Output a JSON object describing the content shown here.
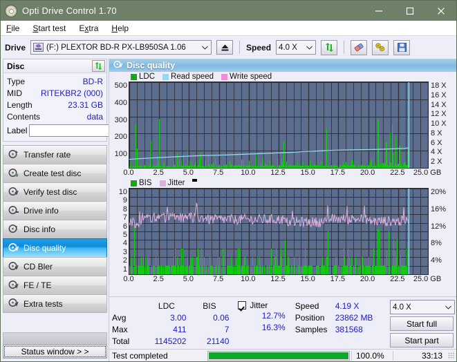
{
  "window": {
    "title": "Opti Drive Control 1.70",
    "icon": "disc-icon",
    "minimize": "minimize-icon",
    "maximize": "maximize-icon",
    "close": "close-icon"
  },
  "menu": [
    {
      "label": "File",
      "accel": "F"
    },
    {
      "label": "Start test",
      "accel": "S"
    },
    {
      "label": "Extra",
      "accel": "x"
    },
    {
      "label": "Help",
      "accel": "H"
    }
  ],
  "drivebar": {
    "drive_label": "Drive",
    "drive_value": "(F:)   PLEXTOR BD-R  PX-LB950SA 1.06",
    "eject_icon": "eject-icon",
    "speed_label": "Speed",
    "speed_value": "4.0 X",
    "refresh_icon": "refresh-icon",
    "erase_icon": "eraser-icon",
    "tools_icon": "tools-icon",
    "save_icon": "save-icon"
  },
  "disc_panel": {
    "title": "Disc",
    "refresh_icon": "refresh-icon",
    "rows": [
      {
        "key": "Type",
        "value": "BD-R"
      },
      {
        "key": "MID",
        "value": "RITEKBR2 (000)"
      },
      {
        "key": "Length",
        "value": "23.31 GB"
      },
      {
        "key": "Contents",
        "value": "data"
      }
    ],
    "label_key": "Label",
    "label_value": "",
    "label_placeholder": "",
    "label_button_icon": "disc-icon"
  },
  "sidebar": {
    "items": [
      {
        "label": "Transfer rate",
        "icon": "disc-transfer-icon",
        "selected": false
      },
      {
        "label": "Create test disc",
        "icon": "disc-create-icon",
        "selected": false
      },
      {
        "label": "Verify test disc",
        "icon": "disc-verify-icon",
        "selected": false
      },
      {
        "label": "Drive info",
        "icon": "disc-drive-icon",
        "selected": false
      },
      {
        "label": "Disc info",
        "icon": "disc-info-icon",
        "selected": false
      },
      {
        "label": "Disc quality",
        "icon": "disc-quality-icon",
        "selected": true
      },
      {
        "label": "CD Bler",
        "icon": "disc-bler-icon",
        "selected": false
      },
      {
        "label": "FE / TE",
        "icon": "disc-fete-icon",
        "selected": false
      },
      {
        "label": "Extra tests",
        "icon": "disc-extra-icon",
        "selected": false
      }
    ],
    "status_window_button": "Status window > >"
  },
  "content_header": {
    "title": "Disc quality",
    "icon": "disc-quality-icon"
  },
  "chart_data": [
    {
      "type": "line",
      "name": "ldc-chart",
      "title": "",
      "xlabel": "GB",
      "ylabel": "",
      "xlim": [
        0,
        25
      ],
      "ylim": [
        0,
        500
      ],
      "y2lim": [
        0,
        18
      ],
      "grid": true,
      "legend_position": "top-left",
      "xticks": [
        "0.0",
        "2.5",
        "5.0",
        "7.5",
        "10.0",
        "12.5",
        "15.0",
        "17.5",
        "20.0",
        "22.5",
        "25.0 GB"
      ],
      "yticks": [
        "500",
        "400",
        "300",
        "200",
        "100"
      ],
      "y2ticks": [
        "18 X",
        "16 X",
        "14 X",
        "12 X",
        "10 X",
        "8 X",
        "6 X",
        "4 X",
        "2 X"
      ],
      "legend": [
        {
          "name": "LDC",
          "color": "#14a814"
        },
        {
          "name": "Read speed",
          "color": "#8fdcf5"
        },
        {
          "name": "Write speed",
          "color": "#f58ad8"
        }
      ],
      "series": [
        {
          "name": "Read speed",
          "color": "#8fdcf5",
          "axis": "right",
          "x": [
            0.0,
            0.6,
            1.3,
            2.0,
            2.8,
            3.6,
            4.4,
            5.3,
            6.2,
            7.1,
            8.0,
            9.0,
            10.0,
            11.0,
            12.0,
            13.0,
            14.0,
            14.6,
            15.4,
            16.3,
            17.2,
            18.1,
            19.0,
            20.0,
            21.0,
            22.0,
            23.0,
            23.4
          ],
          "values": [
            1.8,
            1.9,
            2.0,
            2.1,
            2.2,
            2.3,
            2.4,
            2.5,
            2.6,
            2.65,
            2.7,
            2.8,
            2.9,
            3.0,
            3.1,
            3.2,
            3.3,
            3.45,
            3.5,
            3.6,
            3.7,
            3.75,
            3.8,
            3.85,
            3.9,
            4.0,
            4.1,
            4.19
          ]
        },
        {
          "name": "LDC",
          "color": "#14a814",
          "axis": "left",
          "description": "dense green spikes baseline ~20, peaks at 0.5=258, 1.8=160, 2.5=285, 12.9=155, 16.5=232, 20.8=283, 21.8=205, 22.0=252, 22.3=180",
          "max": 411,
          "avg": 3.0
        }
      ],
      "end_marker_x": 23.4,
      "end_marker_color": "#72e0f8"
    },
    {
      "type": "line",
      "name": "bis-jitter-chart",
      "title": "",
      "xlabel": "GB",
      "ylabel": "",
      "xlim": [
        0,
        25
      ],
      "ylim": [
        0,
        10
      ],
      "y2lim": [
        0,
        20
      ],
      "grid": true,
      "legend_position": "top-left",
      "xticks": [
        "0.0",
        "2.5",
        "5.0",
        "7.5",
        "10.0",
        "12.5",
        "15.0",
        "17.5",
        "20.0",
        "22.5",
        "25.0 GB"
      ],
      "yticks": [
        "10",
        "9",
        "8",
        "7",
        "6",
        "5",
        "4",
        "3",
        "2",
        "1"
      ],
      "y2ticks": [
        "20%",
        "16%",
        "12%",
        "8%",
        "4%"
      ],
      "legend": [
        {
          "name": "BIS",
          "color": "#14a814"
        },
        {
          "name": "Jitter",
          "color": "#e0b0dc"
        }
      ],
      "series": [
        {
          "name": "Jitter",
          "color": "#e0b0dc",
          "axis": "right",
          "description": "noisy band oscillating between 11.5% and 14.5%, mean ~12.7%, peaks to 16.3%",
          "avg": 12.7,
          "max": 16.3
        },
        {
          "name": "BIS",
          "color": "#14a814",
          "axis": "left",
          "description": "dense green spikes baseline 1, frequent 2-3, isolated peaks at 0.4=6, 13.0=4, 16.6=5, 20.8=5.3, 21.7=5, 22.1=4",
          "avg": 0.06,
          "max": 7
        }
      ],
      "end_marker_x": 23.4,
      "end_marker_color": "#72e0f8"
    }
  ],
  "stats": {
    "col_headers": [
      "LDC",
      "BIS"
    ],
    "rows": [
      {
        "label": "Avg",
        "ldc": "3.00",
        "bis": "0.06"
      },
      {
        "label": "Max",
        "ldc": "411",
        "bis": "7"
      },
      {
        "label": "Total",
        "ldc": "1145202",
        "bis": "21140"
      }
    ],
    "jitter": {
      "label": "Jitter",
      "checked": true,
      "avg": "12.7%",
      "max": "16.3%"
    },
    "speed": {
      "label": "Speed",
      "value": "4.19 X"
    },
    "position": {
      "label": "Position",
      "value": "23862 MB"
    },
    "samples": {
      "label": "Samples",
      "value": "381568"
    },
    "speed_select": "4.0 X",
    "start_full": "Start full",
    "start_part": "Start part"
  },
  "statusbar": {
    "message": "Test completed",
    "progress": 100,
    "percent": "100.0%",
    "time": "33:13"
  }
}
